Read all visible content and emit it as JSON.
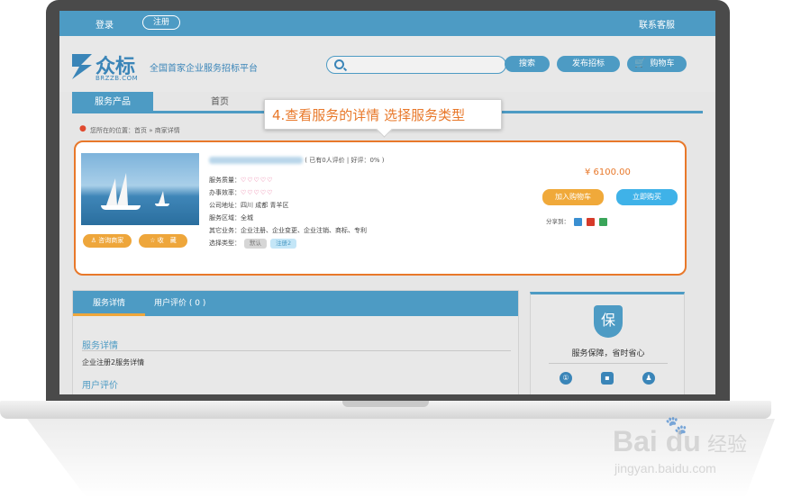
{
  "topbar": {
    "login": "登录",
    "register": "注册",
    "service": "联系客服"
  },
  "header": {
    "logo_text": "众标",
    "logo_domain": "BRZZB.COM",
    "slogan": "全国首家企业服务招标平台",
    "search_button": "搜索",
    "publish_button": "发布招标",
    "cart_button": "购物车"
  },
  "nav": {
    "items": [
      "服务产品",
      "首页"
    ]
  },
  "breadcrumb": "您所在的位置：首页 » 商家详情",
  "callout": "4.查看服务的详情 选择服务类型",
  "product": {
    "rating_text": "( 已有0人评价 | 好评：0% )",
    "quality_label": "服务质量：",
    "efficiency_label": "办事效率：",
    "hearts": "♡♡♡♡♡",
    "address": "公司地址：四川 成都 青羊区",
    "area": "服务区域：全城",
    "other": "其它业务：企业注册、企业变更、企业注销、商标、专利",
    "type_label": "选择类型：",
    "types": [
      "默认",
      "注册2"
    ],
    "consult_button": "咨询商家",
    "favorite_button": "收　藏",
    "price": "¥ 6100.00",
    "add_cart_button": "加入购物车",
    "buy_button": "立即购买",
    "share_label": "分享到："
  },
  "detail": {
    "tabs": [
      "服务详情",
      "用户评价 ( 0 )"
    ],
    "section1_title": "服务详情",
    "section1_text": "企业注册2服务详情",
    "section2_title": "用户评价"
  },
  "guarantee": {
    "shield_char": "保",
    "text": "服务保障，省时省心"
  },
  "watermark": {
    "main": "Bai du",
    "cn": "经验",
    "url": "jingyan.baidu.com"
  },
  "colors": {
    "primary": "#4d9bc4",
    "accent": "#e8782a",
    "button_orange": "#eea63b",
    "button_blue": "#3fb2e8"
  }
}
